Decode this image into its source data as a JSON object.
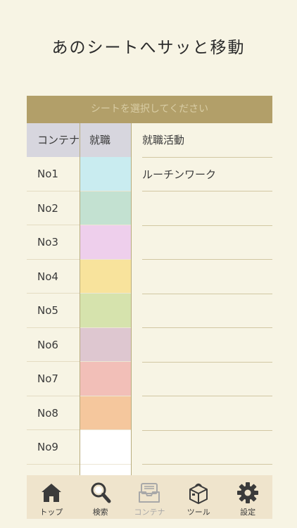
{
  "headline": "あのシートへサッと移動",
  "sheet_selector": {
    "placeholder": "シートを選択してください"
  },
  "table": {
    "header": {
      "col_a": "コンテナ",
      "col_b": "就職"
    },
    "rows": [
      {
        "label": "",
        "color": "#d7d6de",
        "text": "就職活動"
      },
      {
        "label": "No1",
        "color": "#c9ecf0",
        "text": "ルーチンワーク"
      },
      {
        "label": "No2",
        "color": "#c3e1d1",
        "text": ""
      },
      {
        "label": "No3",
        "color": "#eecfec",
        "text": ""
      },
      {
        "label": "No4",
        "color": "#f8e39c",
        "text": ""
      },
      {
        "label": "No5",
        "color": "#d6e3ad",
        "text": ""
      },
      {
        "label": "No6",
        "color": "#dec7d0",
        "text": ""
      },
      {
        "label": "No7",
        "color": "#f2bfb8",
        "text": ""
      },
      {
        "label": "No8",
        "color": "#f5c79d",
        "text": ""
      },
      {
        "label": "No9",
        "color": "#ffffff",
        "text": ""
      }
    ]
  },
  "tabs": [
    {
      "label": "トップ",
      "icon": "home-icon"
    },
    {
      "label": "検索",
      "icon": "search-icon"
    },
    {
      "label": "コンテナ",
      "icon": "tray-icon",
      "active": true
    },
    {
      "label": "ツール",
      "icon": "toolbox-icon"
    },
    {
      "label": "設定",
      "icon": "gear-icon"
    }
  ],
  "colors": {
    "accent": "#b29f69",
    "background": "#f7f4e4",
    "tabbar": "#efe4cc"
  }
}
